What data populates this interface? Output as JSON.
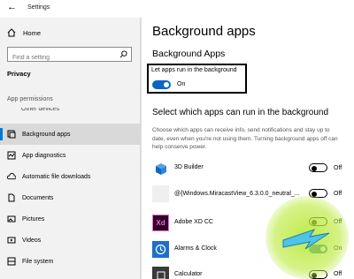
{
  "window": {
    "title": "Settings",
    "back_glyph": "←",
    "controls": [
      "—",
      "☐",
      "✕"
    ]
  },
  "sidebar": {
    "home": "Home",
    "search_placeholder": "Find a setting",
    "category": "Privacy",
    "section_title": "App permissions",
    "partial_item": "Other devices",
    "items": [
      {
        "label": "Background apps",
        "icon": "background-apps-icon",
        "active": true
      },
      {
        "label": "App diagnostics",
        "icon": "app-diagnostics-icon",
        "active": false
      },
      {
        "label": "Automatic file downloads",
        "icon": "cloud-icon",
        "active": false
      },
      {
        "label": "Documents",
        "icon": "document-icon",
        "active": false
      },
      {
        "label": "Pictures",
        "icon": "pictures-icon",
        "active": false
      },
      {
        "label": "Videos",
        "icon": "videos-icon",
        "active": false
      },
      {
        "label": "File system",
        "icon": "file-system-icon",
        "active": false
      }
    ]
  },
  "main": {
    "title": "Background apps",
    "subtitle": "Background Apps",
    "master_toggle": {
      "label": "Let apps run in the background",
      "state": "On",
      "on": true
    },
    "list_heading": "Select which apps can run in the background",
    "description": "Choose which apps can receive info, send notifications and stay up to date, even when you're not using them. Turning background apps off can help conserve power.",
    "apps": [
      {
        "name": "3D Builder",
        "state": "Off",
        "on": false,
        "icon": "3d-builder-icon"
      },
      {
        "name": "@{Windows.MiracastView_6.3.0.0_neutral_...",
        "state": "Off",
        "on": false,
        "icon": "blank-app-icon"
      },
      {
        "name": "Adobe XD CC",
        "state": "Off",
        "on": false,
        "icon": "adobe-xd-icon",
        "icon_text": "Xd"
      },
      {
        "name": "Alarms & Clock",
        "state": "On",
        "on": true,
        "icon": "alarm-clock-icon"
      },
      {
        "name": "Calculator",
        "state": "Off",
        "on": false,
        "icon": "calculator-icon"
      }
    ]
  },
  "colors": {
    "accent": "#0078d7",
    "sidebar_bg": "#f2f2f2",
    "toggle_on": "#0a66c2",
    "adobe_xd_bg": "#2e001f",
    "adobe_xd_fg": "#ff61f6"
  }
}
